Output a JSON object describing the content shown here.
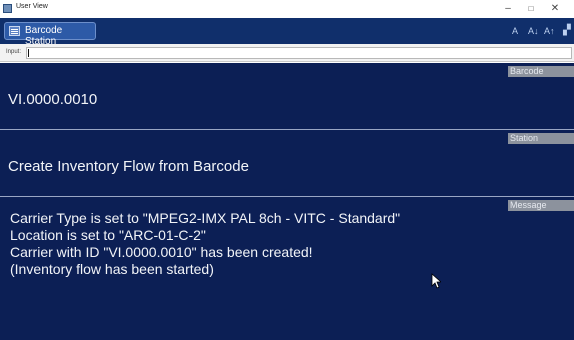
{
  "window": {
    "title": "User View",
    "controls": {
      "minimize": "–",
      "maximize": "□",
      "close": "✕"
    }
  },
  "toolbar": {
    "tab_label": "Barcode Station",
    "tab_icon": "barcode-station-icon",
    "icons": [
      "font-small-icon",
      "font-decrease-icon",
      "font-increase-icon",
      "settings-icon"
    ]
  },
  "input": {
    "label": "Input:",
    "value": ""
  },
  "barcode": {
    "tag": "Barcode",
    "value": "VI.0000.0010"
  },
  "station": {
    "tag": "Station",
    "value": "Create Inventory Flow from Barcode"
  },
  "message": {
    "tag": "Message",
    "lines": [
      "Carrier Type is set to \"MPEG2-IMX PAL 8ch - VITC - Standard\"",
      "Location is set to \"ARC-01-C-2\"",
      "Carrier with ID \"VI.0000.0010\" has been created!",
      "(Inventory flow has been started)"
    ]
  },
  "colors": {
    "panel_bg": "#0c1f55",
    "toolbar_bg": "#102f6b",
    "tab_bg": "#2d5aa7",
    "section_tag_bg": "#8c929d",
    "text": "#f2f4f8"
  }
}
